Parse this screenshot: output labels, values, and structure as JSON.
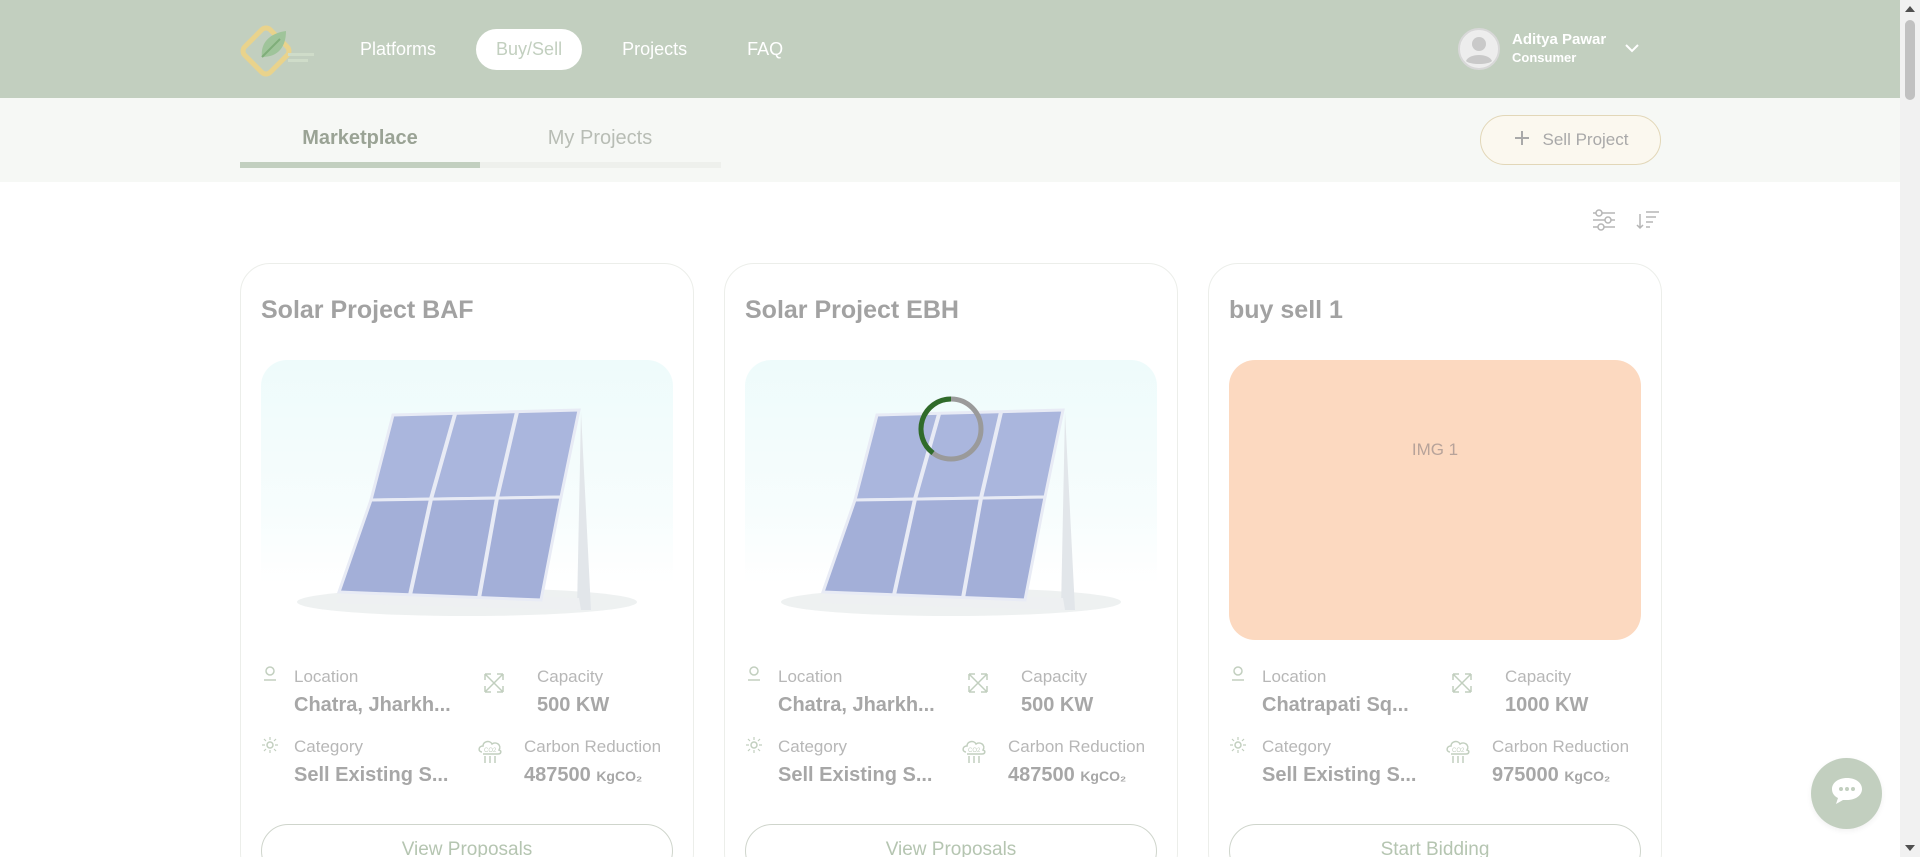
{
  "header": {
    "nav": [
      "Platforms",
      "Buy/Sell",
      "Projects",
      "FAQ"
    ],
    "active_nav": "Buy/Sell",
    "user": {
      "name": "Aditya Pawar",
      "role": "Consumer"
    }
  },
  "subbar": {
    "tabs": [
      "Marketplace",
      "My Projects"
    ],
    "active_tab": "Marketplace",
    "sell_button": "Sell Project"
  },
  "labels": {
    "location": "Location",
    "capacity": "Capacity",
    "category": "Category",
    "carbon": "Carbon Reduction"
  },
  "cards": [
    {
      "title": "Solar Project BAF",
      "location": "Chatra, Jharkh...",
      "capacity": "500 KW",
      "category": "Sell Existing S...",
      "carbon": "487500",
      "unit": "KgCO₂",
      "button": "View Proposals"
    },
    {
      "title": "Solar Project EBH",
      "location": "Chatra, Jharkh...",
      "capacity": "500 KW",
      "category": "Sell Existing S...",
      "carbon": "487500",
      "unit": "KgCO₂",
      "button": "View Proposals"
    },
    {
      "title": "buy sell 1",
      "image_text": "IMG 1",
      "location": "Chatrapati Sq...",
      "capacity": "1000 KW",
      "category": "Sell Existing S...",
      "carbon": "975000",
      "unit": "KgCO₂",
      "button": "Start Bidding"
    }
  ],
  "colors": {
    "header_bg": "#c2cfbf",
    "subbar_bg": "#f6f8f5",
    "placeholder_bg": "#fcd9c0"
  }
}
